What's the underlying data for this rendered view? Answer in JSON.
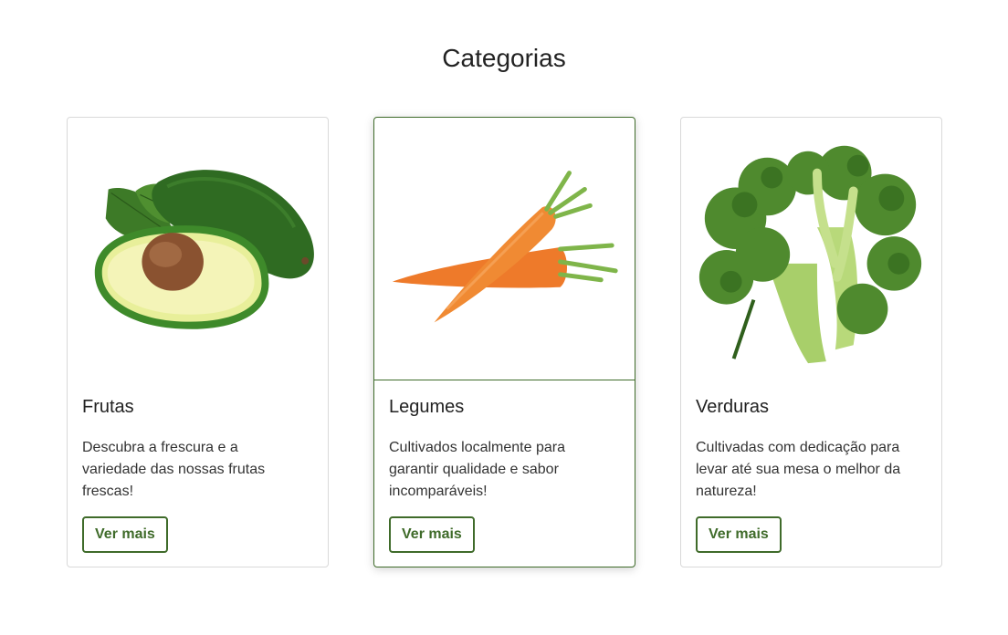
{
  "section": {
    "title": "Categorias"
  },
  "cards": [
    {
      "title": "Frutas",
      "description": "Descubra a frescura e a variedade das nossas frutas frescas!",
      "button_label": "Ver mais",
      "image_icon": "avocado-image"
    },
    {
      "title": "Legumes",
      "description": "Cultivados localmente para garantir qualidade e sabor incomparáveis!",
      "button_label": "Ver mais",
      "image_icon": "carrot-image"
    },
    {
      "title": "Verduras",
      "description": "Cultivadas com dedicação para levar até sua mesa o melhor da natureza!",
      "button_label": "Ver mais",
      "image_icon": "broccoli-image"
    }
  ],
  "colors": {
    "accent": "#3f6b2a",
    "border": "#d9d9d9",
    "text": "#212529"
  }
}
